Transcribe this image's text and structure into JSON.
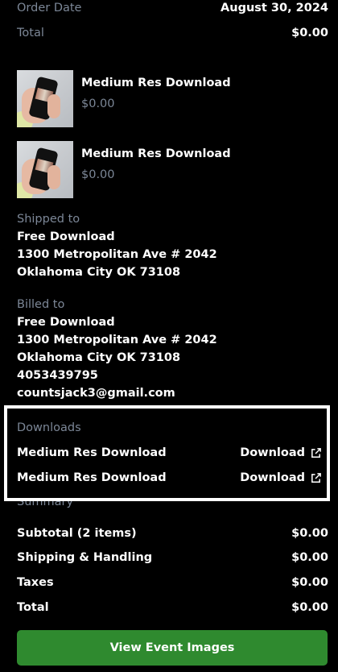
{
  "order": {
    "date_label": "Order Date",
    "date_value": "August 30, 2024",
    "total_label": "Total",
    "total_value": "$0.00"
  },
  "items": [
    {
      "title": "Medium Res Download",
      "price": "$0.00"
    },
    {
      "title": "Medium Res Download",
      "price": "$0.00"
    }
  ],
  "shipped_to": {
    "label": "Shipped to",
    "lines": [
      "Free Download",
      "1300 Metropolitan Ave # 2042",
      "Oklahoma City OK 73108"
    ]
  },
  "billed_to": {
    "label": "Billed to",
    "lines": [
      "Free Download",
      "1300 Metropolitan Ave # 2042",
      "Oklahoma City OK 73108",
      "4053439795",
      "countsjack3@gmail.com"
    ]
  },
  "downloads": {
    "label": "Downloads",
    "rows": [
      {
        "name": "Medium Res Download",
        "link": "Download",
        "icon": "external-link-icon"
      },
      {
        "name": "Medium Res Download",
        "link": "Download",
        "icon": "external-link-icon"
      }
    ]
  },
  "summary": {
    "label": "Summary",
    "rows": [
      {
        "label": "Subtotal (2 items)",
        "value": "$0.00"
      },
      {
        "label": "Shipping & Handling",
        "value": "$0.00"
      },
      {
        "label": "Taxes",
        "value": "$0.00"
      },
      {
        "label": "Total",
        "value": "$0.00"
      }
    ]
  },
  "actions": {
    "view_event_images": "View Event Images"
  },
  "colors": {
    "background": "#000000",
    "muted_text": "#7c8797",
    "button_green": "#2f8a2f",
    "highlight_border": "#ffffff"
  }
}
